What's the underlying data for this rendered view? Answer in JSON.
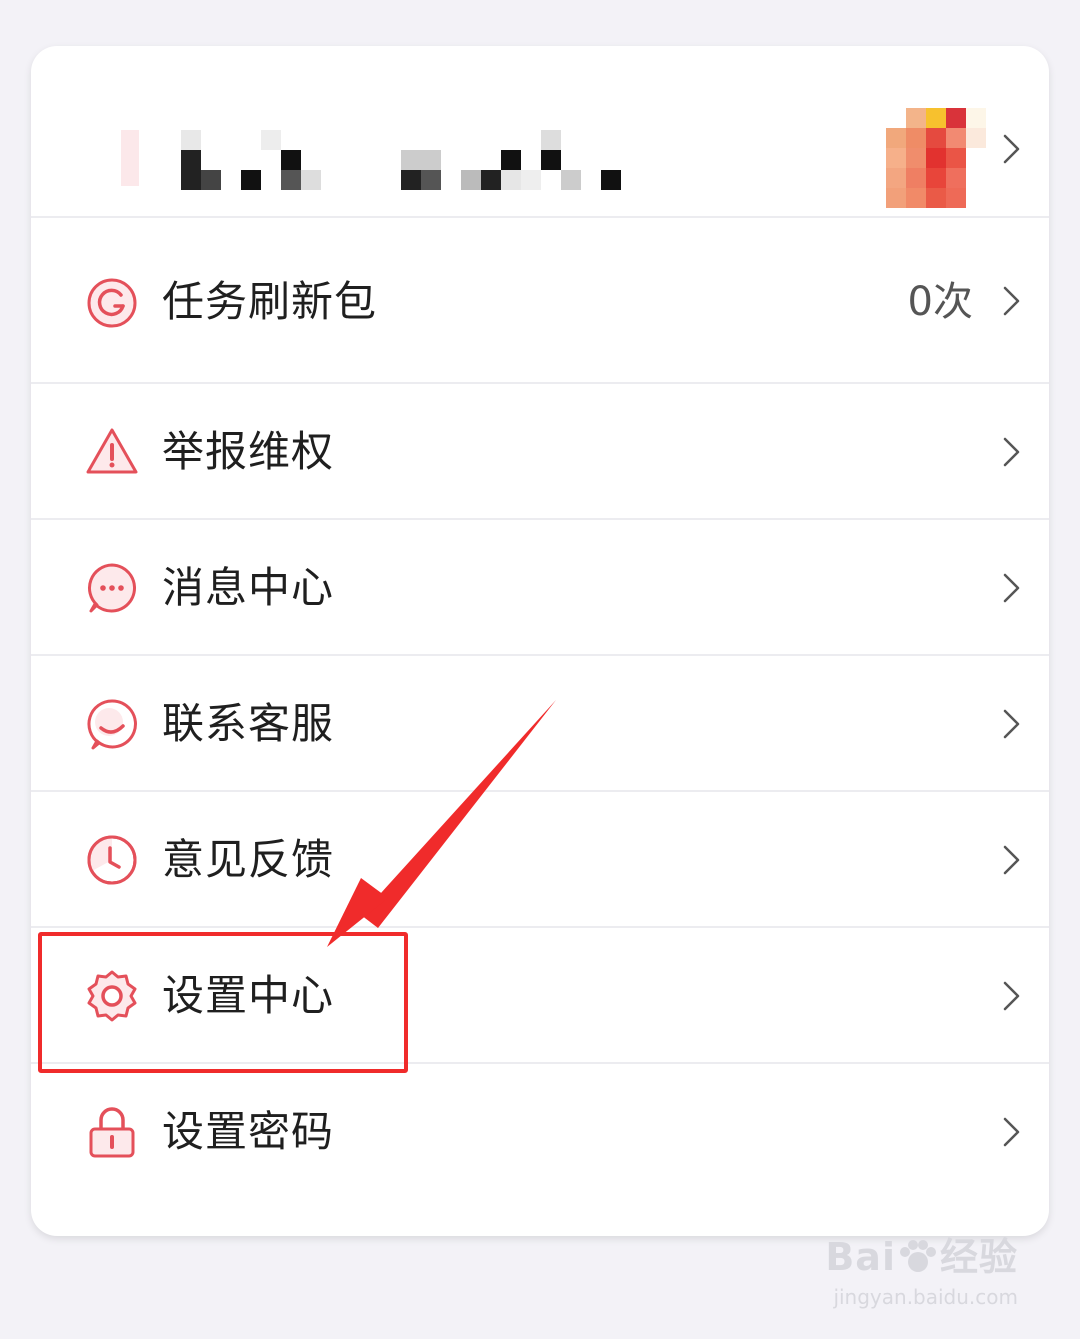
{
  "menu": {
    "items": [
      {
        "label": "任务刷新包",
        "value": "0次",
        "icon": "refresh-icon"
      },
      {
        "label": "举报维权",
        "icon": "warning-icon"
      },
      {
        "label": "消息中心",
        "icon": "message-icon"
      },
      {
        "label": "联系客服",
        "icon": "customer-service-icon"
      },
      {
        "label": "意见反馈",
        "icon": "clock-icon"
      },
      {
        "label": "设置中心",
        "icon": "gear-icon"
      },
      {
        "label": "设置密码",
        "icon": "lock-icon"
      }
    ]
  },
  "annotation": {
    "highlighted_item": "设置中心",
    "color": "#f02b2b"
  },
  "watermark": {
    "brand": "Bai",
    "suffix": "经验",
    "url": "jingyan.baidu.com"
  },
  "colors": {
    "icon_accent": "#e4505a",
    "background": "#f3f2f7",
    "card": "#ffffff"
  }
}
